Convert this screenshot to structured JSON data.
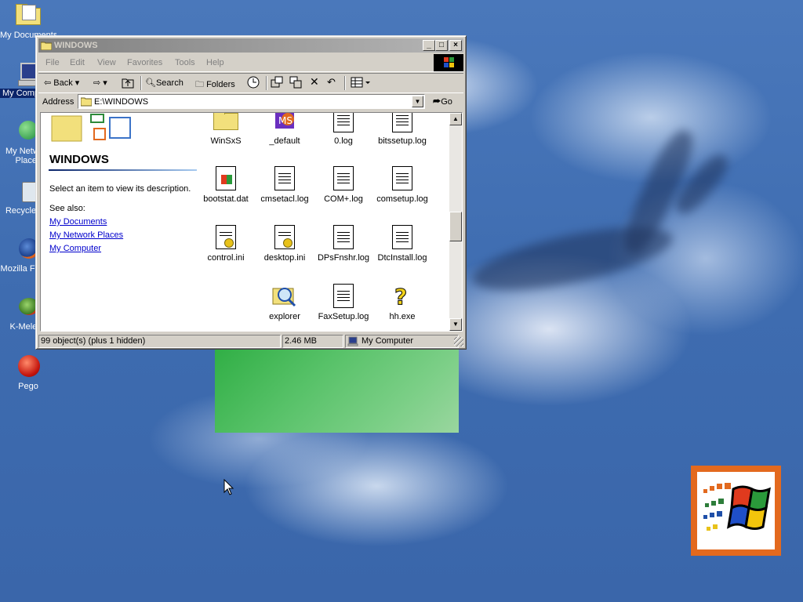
{
  "desktop": {
    "icons": [
      {
        "label": "My Documents"
      },
      {
        "label": "My Computer"
      },
      {
        "label": "My Network Places"
      },
      {
        "label": "Recycle Bin"
      },
      {
        "label": "Mozilla Firefox"
      },
      {
        "label": "K-Meleon"
      },
      {
        "label": "Pego"
      }
    ]
  },
  "window": {
    "title": "WINDOWS",
    "menu": [
      "File",
      "Edit",
      "View",
      "Favorites",
      "Tools",
      "Help"
    ],
    "toolbar": {
      "back": "Back",
      "search": "Search",
      "folders": "Folders"
    },
    "address": {
      "label": "Address",
      "value": "E:\\WINDOWS",
      "go": "Go"
    },
    "left_pane": {
      "heading": "WINDOWS",
      "description": "Select an item to view its description.",
      "see_also": "See also:",
      "links": [
        "My Documents",
        "My Network Places",
        "My Computer"
      ]
    },
    "files": [
      {
        "name": "WinSxS",
        "icon": "folder-icon"
      },
      {
        "name": "_default",
        "icon": "pif-shortcut-icon"
      },
      {
        "name": "0.log",
        "icon": "text-document-icon"
      },
      {
        "name": "bitssetup.log",
        "icon": "text-document-icon"
      },
      {
        "name": "bootstat.dat",
        "icon": "system-file-icon"
      },
      {
        "name": "cmsetacl.log",
        "icon": "text-document-icon"
      },
      {
        "name": "COM+.log",
        "icon": "text-document-icon"
      },
      {
        "name": "comsetup.log",
        "icon": "text-document-icon"
      },
      {
        "name": "control.ini",
        "icon": "ini-settings-icon"
      },
      {
        "name": "desktop.ini",
        "icon": "ini-settings-icon"
      },
      {
        "name": "DPsFnshr.log",
        "icon": "text-document-icon"
      },
      {
        "name": "DtcInstall.log",
        "icon": "text-document-icon"
      },
      {
        "name": "explorer",
        "icon": "explorer-magnifier-icon"
      },
      {
        "name": "FaxSetup.log",
        "icon": "text-document-icon"
      },
      {
        "name": "hh.exe",
        "icon": "help-question-icon"
      }
    ],
    "status": {
      "objects": "99 object(s) (plus 1 hidden)",
      "size": "2.46 MB",
      "location": "My Computer"
    }
  },
  "colors": {
    "desktop_blue": "#3f6db0",
    "inactive_title": "#808080",
    "link_blue": "#0000cc",
    "logo_orange": "#e3691e"
  }
}
